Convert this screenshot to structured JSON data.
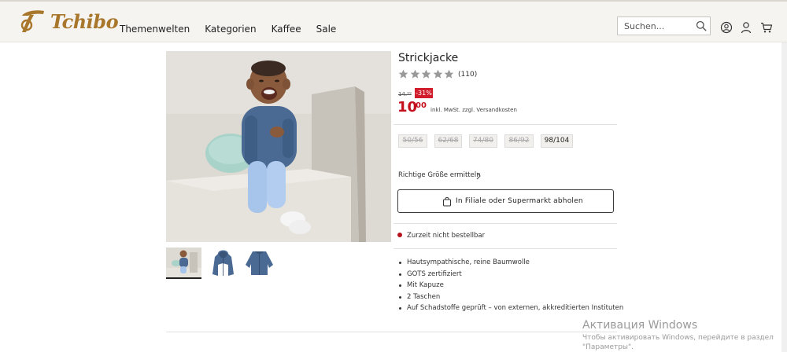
{
  "brand": {
    "logo_text": "Tchibo",
    "color": "#a9772b"
  },
  "nav": [
    "Themenwelten",
    "Kategorien",
    "Kaffee",
    "Sale"
  ],
  "search": {
    "placeholder": "Suchen...",
    "icon": "search-icon"
  },
  "header_icons": [
    "user-profile-icon",
    "account-icon",
    "cart-icon"
  ],
  "product": {
    "title": "Strickjacke",
    "rating": {
      "stars": 5,
      "max": 5,
      "count": "(110)"
    },
    "old_price": "14.⁹⁹",
    "discount": "-31%",
    "price_main": "10",
    "price_cents": "00",
    "price_note": "inkl. MwSt. zzgl. Versandkosten",
    "sizes": [
      {
        "label": "50/56",
        "available": false
      },
      {
        "label": "62/68",
        "available": false
      },
      {
        "label": "74/80",
        "available": false
      },
      {
        "label": "86/92",
        "available": false
      },
      {
        "label": "98/104",
        "available": true
      }
    ],
    "size_guide": "Richtige Größe ermitteln",
    "pickup_button": "In Filiale oder Supermarkt abholen",
    "availability": "Zurzeit nicht bestellbar",
    "features": [
      "Hautsympathische, reine Baumwolle",
      "GOTS zertifiziert",
      "Mit Kapuze",
      "2 Taschen",
      "Auf Schadstoffe geprüft – von externen, akkreditierten Instituten"
    ]
  },
  "colors": {
    "price_red": "#c4101e",
    "badge_red": "#d01c2b",
    "jacket_blue": "#4a6a93"
  },
  "watermark": {
    "title": "Активация Windows",
    "line1": "Чтобы активировать Windows, перейдите в раздел",
    "line2": "\"Параметры\"."
  }
}
